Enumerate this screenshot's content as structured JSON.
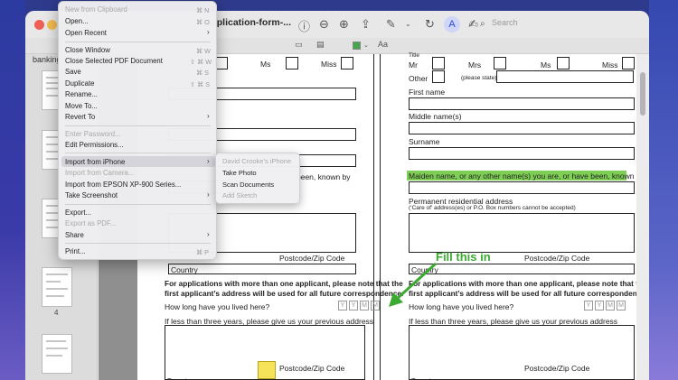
{
  "window": {
    "title": "-application-form-...",
    "search_placeholder": "Search"
  },
  "sidebar": {
    "title": "banking",
    "page_numbers": [
      "4"
    ]
  },
  "form": {
    "titles_left": [
      "Ms",
      "Miss"
    ],
    "titles_right": [
      "Title",
      "Mr",
      "Mrs",
      "Ms",
      "Miss"
    ],
    "other_label": "Other",
    "please_state": "(please state)",
    "first_name": "First name",
    "middle_names": "Middle name(s)",
    "surname": "Surname",
    "maiden_name_left": "been, known by",
    "maiden_name": "Maiden name, or any other name(s) you are, or have been, known by",
    "perm_address": "Permanent residential address",
    "perm_address_note": "(‘Care of’ address(es) or P.O. Box numbers cannot be accepted)",
    "postcode": "Postcode/Zip Code",
    "country": "Country",
    "multi_notice_1": "For applications with more than one applicant, please note that the",
    "multi_notice_2": "first applicant’s address will be used for all future correspondence.",
    "how_long": "How long have you lived here?",
    "year_box": "Y",
    "month_box": "M",
    "prev_address": "If less than three years, please give us your previous address"
  },
  "annotation": {
    "label": "Fill this in",
    "color": "#3caa31"
  },
  "highlight_color": "#7fcf57",
  "menu": {
    "items": [
      {
        "label": "New from Clipboard",
        "shortcut": "⌘ N",
        "disabled": true
      },
      {
        "label": "Open...",
        "shortcut": "⌘ O"
      },
      {
        "label": "Open Recent",
        "submenu": true
      },
      {
        "label": "Close Window",
        "shortcut": "⌘ W"
      },
      {
        "label": "Close Selected PDF Document",
        "shortcut": "⇧ ⌘ W"
      },
      {
        "label": "Save",
        "shortcut": "⌘ S"
      },
      {
        "label": "Duplicate",
        "shortcut": "⇧ ⌘ S"
      },
      {
        "label": "Rename..."
      },
      {
        "label": "Move To..."
      },
      {
        "label": "Revert To",
        "submenu": true
      },
      {
        "label": "Enter Password...",
        "disabled": true
      },
      {
        "label": "Edit Permissions..."
      },
      {
        "label": "Import from iPhone",
        "submenu": true,
        "highlighted": true
      },
      {
        "label": "Import from Camera...",
        "disabled": true
      },
      {
        "label": "Import from EPSON XP-900 Series..."
      },
      {
        "label": "Take Screenshot",
        "submenu": true
      },
      {
        "label": "Export..."
      },
      {
        "label": "Export as PDF...",
        "disabled": true
      },
      {
        "label": "Share",
        "submenu": true
      },
      {
        "label": "Print...",
        "shortcut": "⌘ P"
      }
    ],
    "submenu": [
      {
        "label": "David Crooke’s iPhone",
        "disabled": true
      },
      {
        "label": "Take Photo"
      },
      {
        "label": "Scan Documents"
      },
      {
        "label": "Add Sketch",
        "disabled": true
      }
    ]
  }
}
